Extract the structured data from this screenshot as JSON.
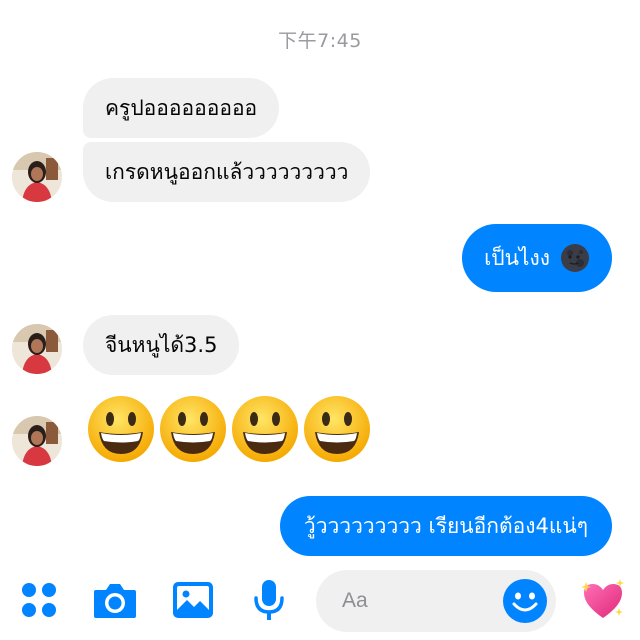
{
  "conversation": {
    "timestamp": "下午7:45",
    "messages": [
      {
        "from": "contact",
        "text": "ครูปอออออออออ"
      },
      {
        "from": "contact",
        "text": "เกรดหนูออกแล้ววววววววว"
      },
      {
        "from": "me",
        "text": "เป็นไงง",
        "emoji": "new-moon-face"
      },
      {
        "from": "contact",
        "text": "จีนหนูได้3.5"
      },
      {
        "from": "contact",
        "emoji": [
          "grinning-face",
          "grinning-face",
          "grinning-face",
          "grinning-face"
        ]
      },
      {
        "from": "me",
        "text": "วู้ววววววววว เรียนอีกต้อง4แน่ๆ"
      }
    ]
  },
  "composer": {
    "placeholder": "Aa",
    "icons": [
      "more-dots-icon",
      "camera-icon",
      "photo-icon",
      "microphone-icon",
      "smiley-icon",
      "sparkling-heart-icon"
    ]
  },
  "colors": {
    "accent": "#0084ff",
    "incoming_bubble": "#f0f0f0",
    "timestamp": "#9a9a9f"
  }
}
